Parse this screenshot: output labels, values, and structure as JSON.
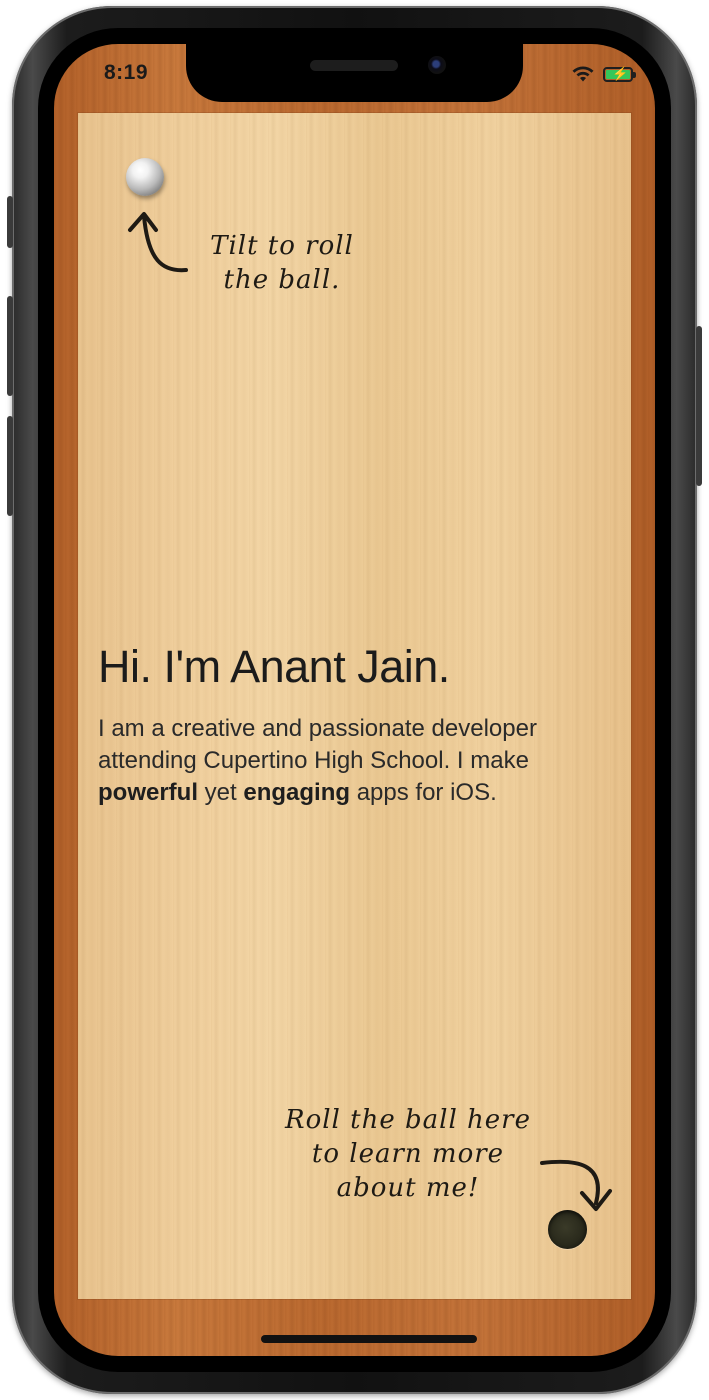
{
  "status_bar": {
    "time": "8:19",
    "icons": [
      "wifi-icon",
      "battery-charging-icon"
    ],
    "battery_color": "#34c759"
  },
  "hints": {
    "top": [
      "Tilt to roll",
      "the ball."
    ],
    "bottom": [
      "Roll the ball here",
      "to learn more",
      "about me!"
    ]
  },
  "intro": {
    "headline": "Hi. I'm Anant Jain.",
    "bio_part1": "I am a creative and passionate developer attending Cupertino High School. I make",
    "bio_bold1": "powerful",
    "bio_part2": "yet",
    "bio_bold2": "engaging",
    "bio_part3": "apps for iOS."
  },
  "colors": {
    "frame_wood": "#c4743a",
    "panel_wood": "#f0cf9d",
    "text": "#1b1b1b"
  }
}
